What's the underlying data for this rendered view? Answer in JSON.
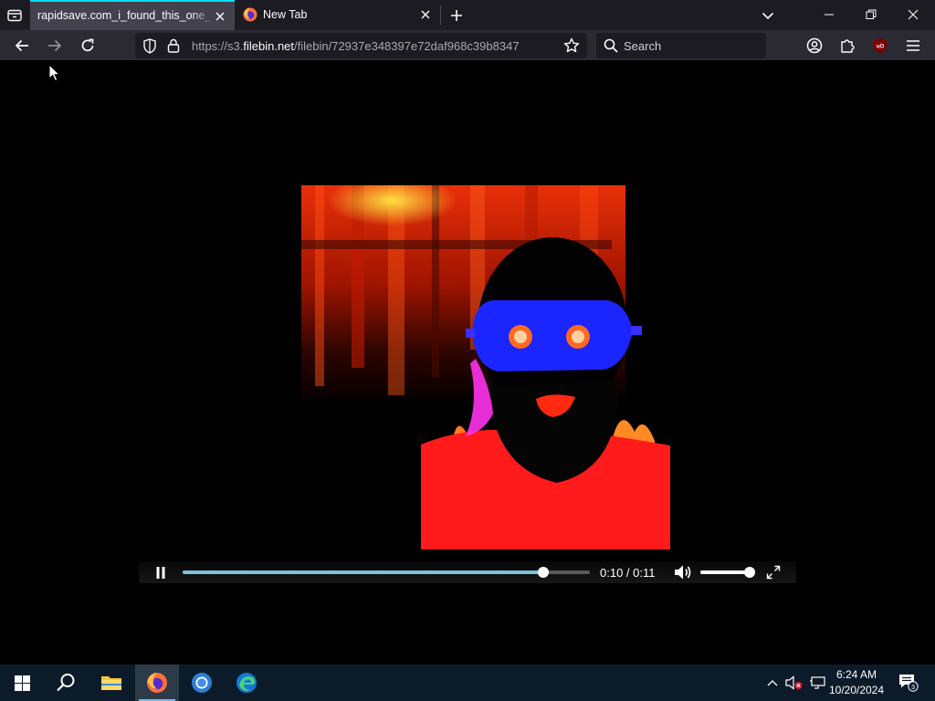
{
  "browser": {
    "tabs": [
      {
        "title": "rapidsave.com_i_found_this_one_on",
        "active": true
      },
      {
        "title": "New Tab",
        "active": false
      }
    ],
    "url": {
      "prefix": "https://s3.",
      "domain": "filebin.net",
      "path": "/filebin/72937e348397e72daf968c39b8347"
    },
    "search": {
      "placeholder": "Search"
    },
    "accent_color": "#00ddff"
  },
  "video": {
    "current_time": "0:10",
    "duration": "0:11",
    "separator": " / ",
    "progress": 0.885,
    "volume": 1.0,
    "playing": true
  },
  "taskbar": {
    "apps": [
      "start-icon",
      "search-icon",
      "file-explorer-icon",
      "firefox-icon",
      "chrome-icon",
      "edge-icon"
    ],
    "active_app": "firefox",
    "clock": {
      "time": "6:24 AM",
      "date": "10/20/2024"
    },
    "notification_count": "3"
  }
}
